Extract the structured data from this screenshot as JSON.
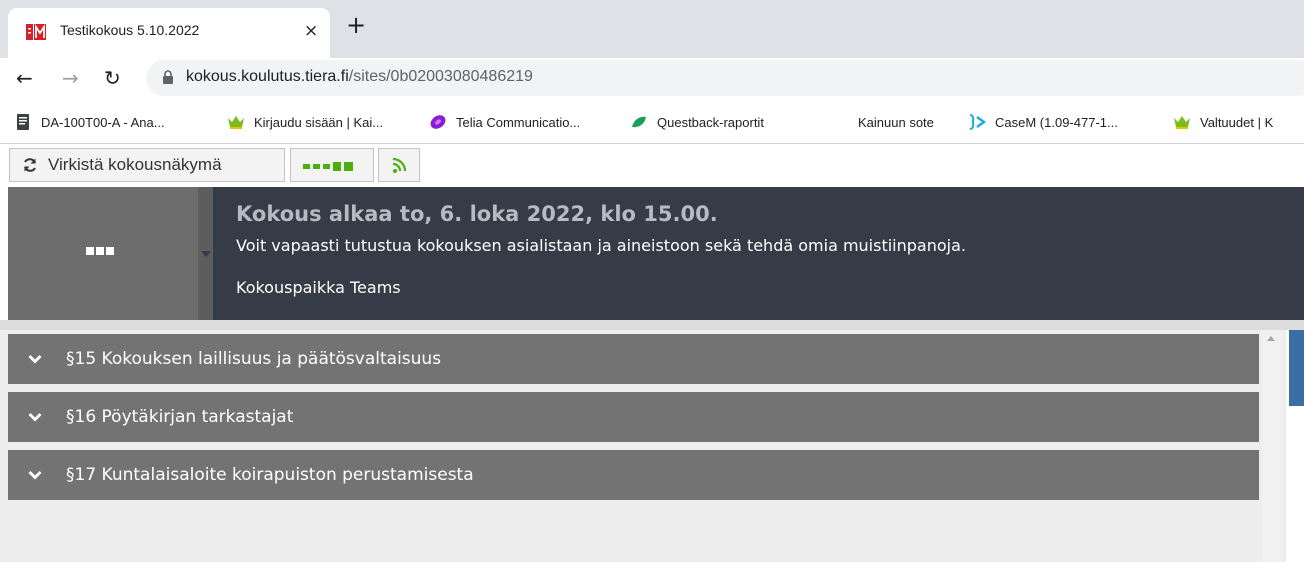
{
  "browser": {
    "tab": {
      "title": "Testikokous 5.10.2022",
      "close": "×",
      "new_tab": "+"
    },
    "nav": {
      "back": "←",
      "forward": "→",
      "reload": "↻"
    },
    "url": {
      "host": "kokous.koulutus.tiera.fi",
      "path": "/sites/0b02003080486219"
    },
    "bookmarks": [
      {
        "label": "DA-100T00-A - Ana...",
        "icon": "document-icon"
      },
      {
        "label": "Kirjaudu sisään | Kai...",
        "icon": "crown-icon"
      },
      {
        "label": "Telia Communicatio...",
        "icon": "telia-icon"
      },
      {
        "label": "Questback-raportit",
        "icon": "leaf-icon"
      },
      {
        "label": "Kainuun sote",
        "icon": ""
      },
      {
        "label": "CaseM (1.09-477-1...",
        "icon": "casem-icon"
      },
      {
        "label": "Valtuudet | K",
        "icon": "crown-icon"
      }
    ]
  },
  "toolbar": {
    "refresh_label": "Virkistä kokousnäkymä"
  },
  "meeting": {
    "side_dots": "...",
    "title": "Kokous alkaa to, 6. loka 2022, klo 15.00.",
    "description": "Voit vapaasti tutustua kokouksen asialistaan ja aineistoon sekä tehdä omia muistiinpanoja.",
    "place": "Kokouspaikka Teams"
  },
  "agenda": [
    {
      "label": "§15 Kokouksen laillisuus ja päätösvaltaisuus"
    },
    {
      "label": "§16 Pöytäkirjan tarkastajat"
    },
    {
      "label": "§17 Kuntalaisaloite koirapuiston perustamisesta"
    }
  ],
  "colors": {
    "header_bg": "#353c47",
    "agenda_item_bg": "#737373",
    "signal_green": "#4caf0a"
  }
}
